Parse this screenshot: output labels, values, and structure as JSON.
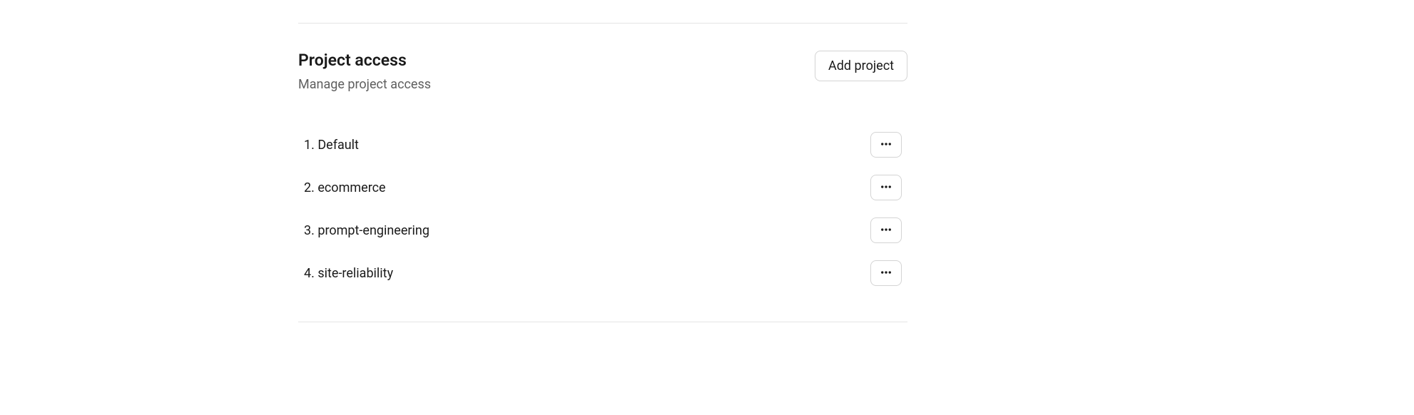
{
  "section": {
    "title": "Project access",
    "subtitle": "Manage project access",
    "add_button_label": "Add project"
  },
  "projects": [
    {
      "name": "Default"
    },
    {
      "name": "ecommerce"
    },
    {
      "name": "prompt-engineering"
    },
    {
      "name": "site-reliability"
    }
  ]
}
